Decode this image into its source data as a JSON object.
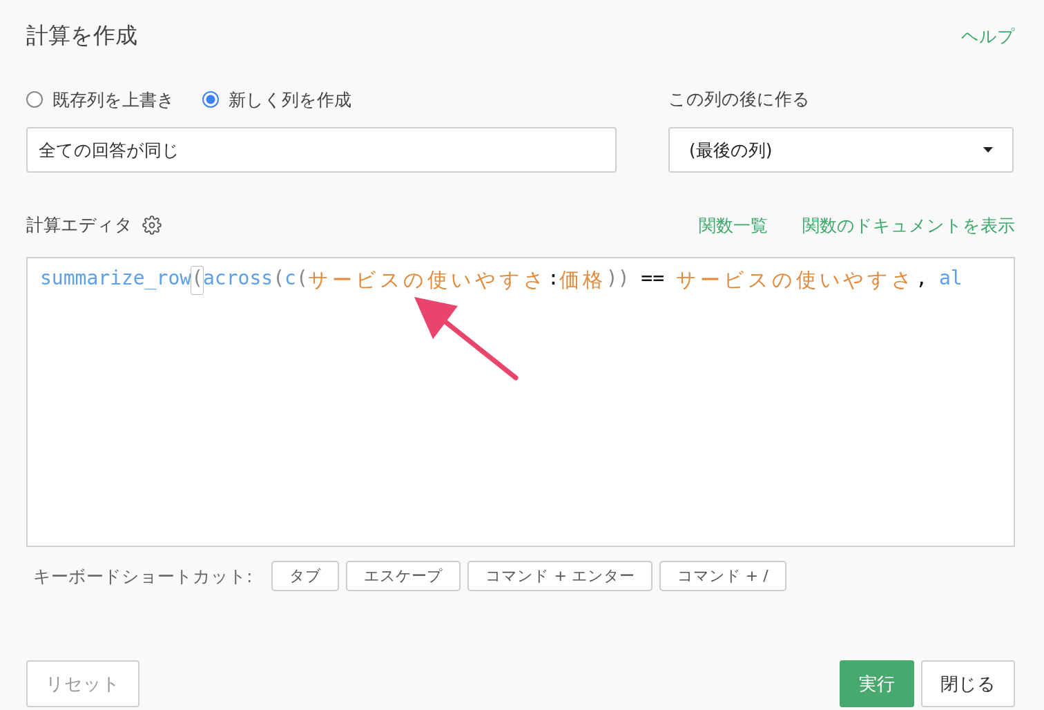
{
  "title": "計算を作成",
  "help": "ヘルプ",
  "radios": [
    {
      "label": "既存列を上書き",
      "selected": false
    },
    {
      "label": "新しく列を作成",
      "selected": true
    }
  ],
  "name_field": {
    "value": "全ての回答が同じ"
  },
  "position": {
    "label": "この列の後に作る",
    "value": "(最後の列)"
  },
  "editor": {
    "label": "計算エディタ",
    "links": [
      "関数一覧",
      "関数のドキュメントを表示"
    ],
    "tokens": [
      {
        "kind": "func",
        "text": "summarize_row"
      },
      {
        "kind": "bracket",
        "text": "("
      },
      {
        "kind": "func",
        "text": "across"
      },
      {
        "kind": "paren",
        "text": "("
      },
      {
        "kind": "func",
        "text": "c"
      },
      {
        "kind": "paren",
        "text": "("
      },
      {
        "kind": "column",
        "text": "サービスの使いやすさ"
      },
      {
        "kind": "op",
        "text": ":"
      },
      {
        "kind": "column",
        "text": "価格"
      },
      {
        "kind": "paren",
        "text": "))"
      },
      {
        "kind": "op",
        "text": " == "
      },
      {
        "kind": "column",
        "text": "サービスの使いやすさ"
      },
      {
        "kind": "op",
        "text": ", "
      },
      {
        "kind": "func",
        "text": "al"
      }
    ]
  },
  "shortcuts": {
    "label": "キーボードショートカット:",
    "keys": [
      "タブ",
      "エスケープ",
      "コマンド + エンター",
      "コマンド + /"
    ]
  },
  "footer": {
    "reset": "リセット",
    "run": "実行",
    "close": "閉じる"
  }
}
